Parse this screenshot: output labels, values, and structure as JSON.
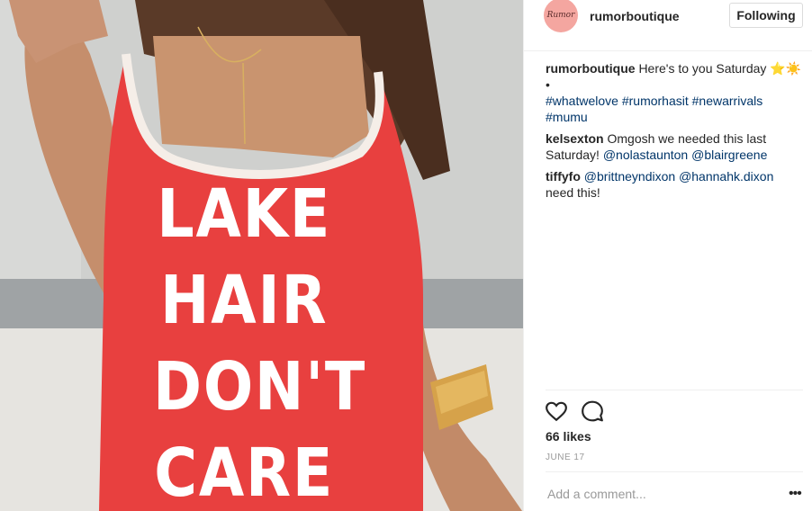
{
  "photo": {
    "shirt_lines": [
      "LAKE",
      "HAIR",
      "DON'T",
      "CARE"
    ]
  },
  "header": {
    "avatar_text": "Rumor",
    "username": "rumorboutique",
    "follow_label": "Following"
  },
  "caption": {
    "user": "rumorboutique",
    "text": "Here's to you Saturday",
    "emoji": "⭐️☀️",
    "bullet": "•",
    "hashtags": [
      "#whatwelove",
      "#rumorhasit",
      "#newarrivals",
      "#mumu"
    ]
  },
  "comments": [
    {
      "user": "kelsexton",
      "text": "Omgosh we needed this last Saturday!",
      "mentions": [
        "@nolastaunton",
        "@blairgreene"
      ]
    },
    {
      "user": "tiffyfo",
      "mentions": [
        "@brittneyndixon",
        "@hannahk.dixon"
      ],
      "text": "need this!"
    }
  ],
  "actions": {
    "like_icon": "heart-icon",
    "comment_icon": "comment-icon",
    "likes": "66 likes",
    "date": "JUNE 17"
  },
  "footer": {
    "add_comment_placeholder": "Add a comment...",
    "more_icon": "more-options-icon",
    "more_symbol": "•••"
  },
  "colors": {
    "shirt_red": "#e8403f",
    "avatar_pink": "#f4a6a0",
    "link_blue": "#003569"
  }
}
